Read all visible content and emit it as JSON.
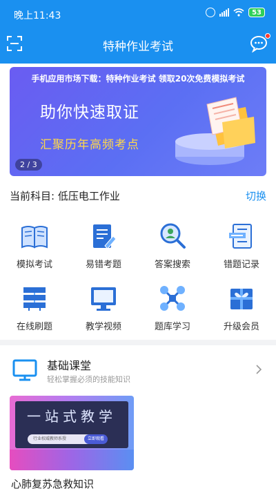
{
  "status": {
    "time": "晚上11:43",
    "battery": "53"
  },
  "header": {
    "title": "特种作业考试"
  },
  "banner": {
    "top_text": "手机应用市场下载：特种作业考试  领取20次免费模拟考试",
    "main_text": "助你快速取证",
    "sub_text": "汇聚历年高频考点",
    "pager": "2 / 3"
  },
  "subject": {
    "label": "当前科目: 低压电工作业",
    "switch": "切换"
  },
  "features": [
    {
      "label": "模拟考试",
      "icon": "book-icon"
    },
    {
      "label": "易错考题",
      "icon": "document-pen-icon"
    },
    {
      "label": "答案搜索",
      "icon": "search-person-icon"
    },
    {
      "label": "错题记录",
      "icon": "record-icon"
    },
    {
      "label": "在线刷题",
      "icon": "layers-icon"
    },
    {
      "label": "教学视频",
      "icon": "monitor-icon"
    },
    {
      "label": "题库学习",
      "icon": "drone-icon"
    },
    {
      "label": "升级会员",
      "icon": "gift-icon"
    }
  ],
  "course": {
    "title": "基础课堂",
    "subtitle": "轻松掌握必须的技能知识",
    "card_title": "一站式教学",
    "card_pill": "行业权威教师系授",
    "card_button": "立即观看",
    "card_name": "心肺复苏急救知识"
  },
  "colors": {
    "primary": "#1a90f0",
    "accent_yellow": "#ffd84a",
    "badge_red": "#ff3b30"
  }
}
